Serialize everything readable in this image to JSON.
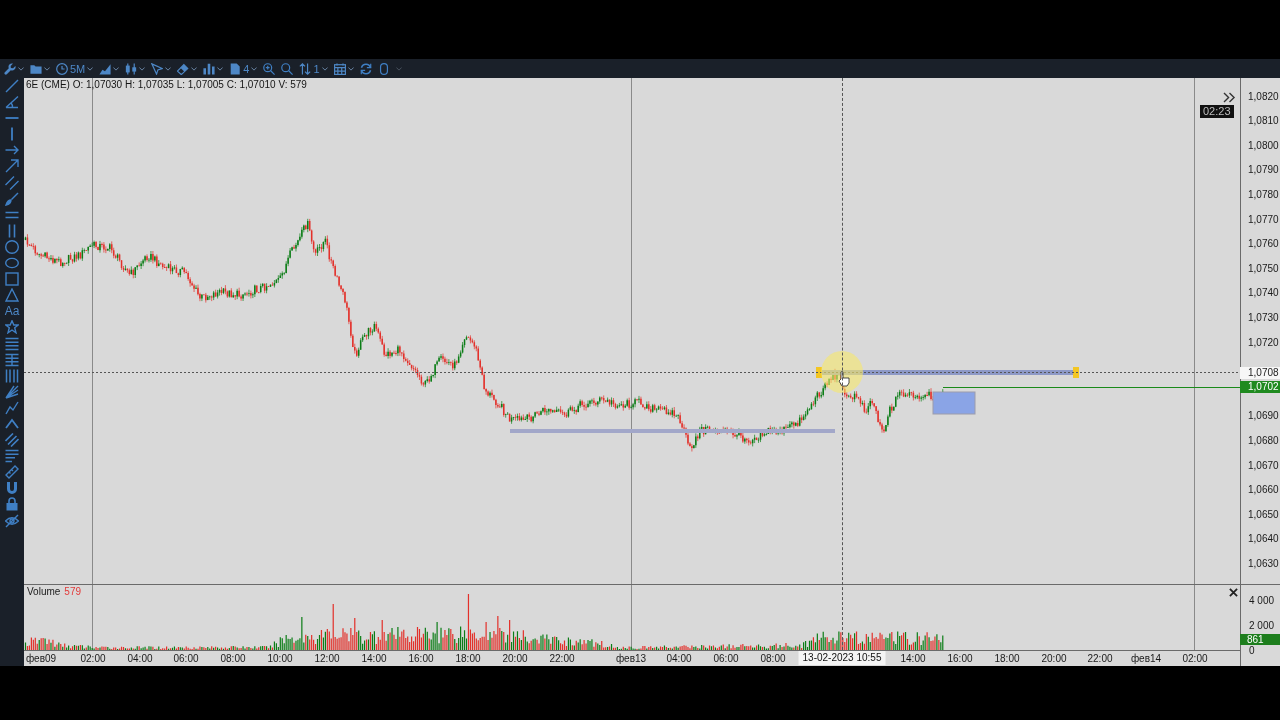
{
  "toolbar": {
    "timeframe": "5M",
    "layout_count": "4",
    "sort_value": "1"
  },
  "drawing_toolbar": {
    "text_tool": "Aa"
  },
  "price_pane": {
    "legend": "6E (CME) O: 1,07030 H: 1,07035 L: 1,07005 C: 1,07010 V: 579",
    "bar_timer": "02:23",
    "crosshair_price": "1,0708",
    "last_price": "1,0702"
  },
  "price_axis": {
    "labels_upper": [
      "1,0820",
      "1,0810",
      "1,0800",
      "1,0790",
      "1,0780",
      "1,0770",
      "1,0760",
      "1,0750",
      "1,0740",
      "1,0730",
      "1,0720"
    ],
    "labels_lower": [
      "1,0690",
      "1,0680",
      "1,0670",
      "1,0660",
      "1,0650",
      "1,0640",
      "1,0630"
    ]
  },
  "volume_pane": {
    "title": "Volume",
    "value": "579",
    "axis_labels": [
      "4 000",
      "2 000",
      "0"
    ],
    "last_volume": "861"
  },
  "time_axis": {
    "labels": [
      "фев09",
      "02:00",
      "04:00",
      "06:00",
      "08:00",
      "10:00",
      "12:00",
      "14:00",
      "16:00",
      "18:00",
      "20:00",
      "22:00",
      "фев13",
      "04:00",
      "06:00",
      "08:00",
      "14:00",
      "16:00",
      "18:00",
      "20:00",
      "22:00",
      "фев14",
      "02:00"
    ],
    "crosshair_time": "13-02-2023 10:55"
  }
}
